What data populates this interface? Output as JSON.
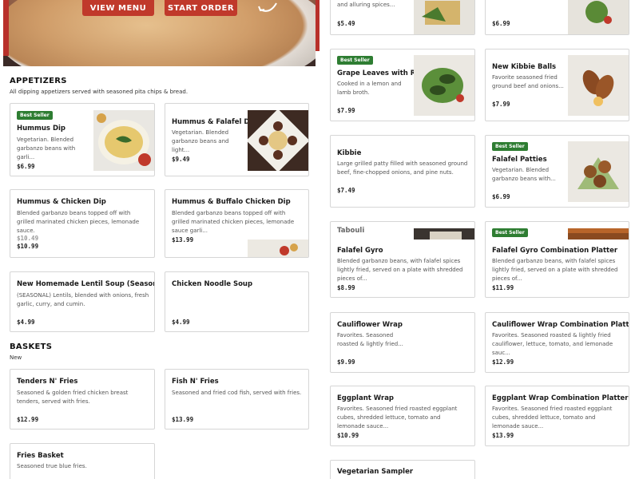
{
  "hero": {
    "view_menu": "VIEW MENU",
    "start_order": "START ORDER"
  },
  "appetizers": {
    "title": "APPETIZERS",
    "subtitle": "All dipping appetizers served with seasoned pita chips & bread."
  },
  "baskets": {
    "title": "BASKETS",
    "subtitle": "New"
  },
  "badge": "Best Seller",
  "left_items": [
    {
      "name": "Hummus Dip",
      "desc": "Vegetarian. Blended garbanzo beans with garli...",
      "price": "$6.99"
    },
    {
      "name": "Hummus & Falafel Dip",
      "desc": "Vegetarian. Blended garbanzo beans and light...",
      "price": "$9.49"
    },
    {
      "name": "Hummus & Chicken Dip",
      "desc": "Blended garbanzo beans topped off with grilled marinated chicken pieces, lemonade sauce.",
      "price": "$10.99"
    },
    {
      "name": "Hummus & Buffalo Chicken Dip",
      "desc": "Blended garbanzo beans topped off with grilled marinated chicken pieces, lemonade sauce garli...",
      "price": "$13.99"
    },
    {
      "name": "New Homemade Lentil Soup (Seasonal)",
      "desc": "(SEASONAL) Lentils, blended with onions, fresh garlic, curry, and cumin.",
      "price": "$4.99"
    },
    {
      "name": "Chicken Noodle Soup",
      "desc": "",
      "price": "$4.99"
    },
    {
      "name": "Tenders N' Fries",
      "desc": "Seasoned & golden fried chicken breast tenders, served with fries.",
      "price": "$12.99"
    },
    {
      "name": "Fish N' Fries",
      "desc": "Seasoned and fried cod fish, served with fries.",
      "price": "$13.99"
    },
    {
      "name": "Fries Basket",
      "desc": "Seasoned true blue fries.",
      "price": ""
    }
  ],
  "right_items": [
    {
      "name": "",
      "desc": "and alluring spices...",
      "price": "$5.49"
    },
    {
      "name": "",
      "desc": "",
      "price": "$6.99"
    },
    {
      "name": "Grape Leaves with Ri...",
      "desc": "Cooked in a lemon and lamb broth.",
      "price": "$7.99"
    },
    {
      "name": "New Kibbie Balls",
      "desc": "Favorite seasoned fried ground beef and onions...",
      "price": "$7.99"
    },
    {
      "name": "Kibbie",
      "desc": "Large grilled patty filled with seasoned ground beef, fine-chopped onions, and pine nuts.",
      "price": "$7.49"
    },
    {
      "name": "Falafel Patties",
      "desc": "Vegetarian. Blended garbanzo beans with...",
      "price": "$6.99"
    },
    {
      "name": "Falafel Gyro",
      "desc": "Blended garbanzo beans, with falafel spices lightly fried, served on a plate with shredded pieces of...",
      "price": "$8.99"
    },
    {
      "name": "Falafel Gyro Combination Platter",
      "desc": "Blended garbanzo beans, with falafel spices lightly fried, served on a plate with shredded pieces of...",
      "price": "$11.99"
    },
    {
      "name": "Cauliflower Wrap",
      "desc": "Favorites. Seasoned roasted & lightly fried...",
      "price": "$9.99"
    },
    {
      "name": "Cauliflower Wrap Combination Platter",
      "desc": "Favorites. Seasoned roasted & lightly fried cauliflower, lettuce, tomato, and lemonade sauc...",
      "price": "$12.99"
    },
    {
      "name": "Eggplant Wrap",
      "desc": "Favorites. Seasoned fried roasted eggplant cubes, shredded lettuce, tomato and lemonade sauce...",
      "price": "$10.99"
    },
    {
      "name": "Eggplant Wrap Combination Platter",
      "desc": "Favorites. Seasoned fried roasted eggplant cubes, shredded lettuce, tomato and lemonade sauce...",
      "price": "$13.99"
    },
    {
      "name": "Vegetarian Sampler",
      "desc": "",
      "price": ""
    }
  ],
  "overlap_texts": {
    "tabouli_peek": "Tabouli",
    "price_peek_a": "$10.49",
    "price_peek_b": "$13.99"
  },
  "colors": {
    "accent": "#c0392b",
    "badge": "#2e7d32"
  }
}
